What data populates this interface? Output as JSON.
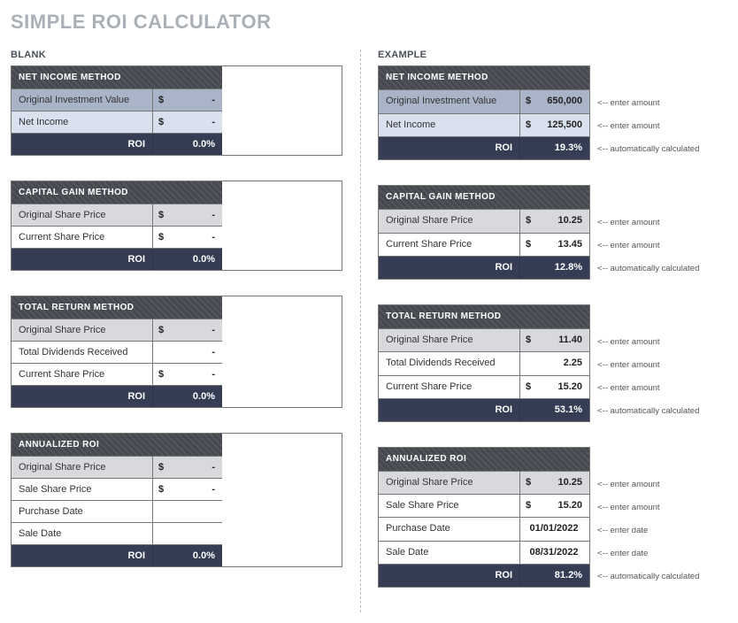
{
  "title": "SIMPLE ROI CALCULATOR",
  "labels": {
    "blank": "BLANK",
    "example": "EXAMPLE",
    "roi": "ROI"
  },
  "methods": {
    "net_income": {
      "title": "NET INCOME METHOD",
      "rows": [
        "Original Investment Value",
        "Net Income"
      ]
    },
    "capital_gain": {
      "title": "CAPITAL GAIN METHOD",
      "rows": [
        "Original Share Price",
        "Current Share Price"
      ]
    },
    "total_return": {
      "title": "TOTAL RETURN METHOD",
      "rows": [
        "Original Share Price",
        "Total Dividends Received",
        "Current Share Price"
      ]
    },
    "annualized": {
      "title": "ANNUALIZED ROI",
      "rows": [
        "Original Share Price",
        "Sale Share Price",
        "Purchase Date",
        "Sale Date"
      ]
    }
  },
  "blank": {
    "net_income": {
      "v": [
        "-",
        "-"
      ],
      "sym": [
        "$",
        "$"
      ],
      "roi": "0.0%"
    },
    "capital_gain": {
      "v": [
        "-",
        "-"
      ],
      "sym": [
        "$",
        "$"
      ],
      "roi": "0.0%"
    },
    "total_return": {
      "v": [
        "-",
        "-",
        "-"
      ],
      "sym": [
        "$",
        "",
        "$"
      ],
      "roi": "0.0%"
    },
    "annualized": {
      "v": [
        "-",
        "-",
        "",
        ""
      ],
      "sym": [
        "$",
        "$",
        "",
        ""
      ],
      "roi": "0.0%"
    }
  },
  "example": {
    "net_income": {
      "v": [
        "650,000",
        "125,500"
      ],
      "sym": [
        "$",
        "$"
      ],
      "roi": "19.3%"
    },
    "capital_gain": {
      "v": [
        "10.25",
        "13.45"
      ],
      "sym": [
        "$",
        "$"
      ],
      "roi": "12.8%"
    },
    "total_return": {
      "v": [
        "11.40",
        "2.25",
        "15.20"
      ],
      "sym": [
        "$",
        "",
        "$"
      ],
      "roi": "53.1%"
    },
    "annualized": {
      "v": [
        "10.25",
        "15.20",
        "01/01/2022",
        "08/31/2022"
      ],
      "sym": [
        "$",
        "$",
        "",
        ""
      ],
      "roi": "81.2%"
    }
  },
  "annot": {
    "amount": "<-- enter amount",
    "date": "<-- enter date",
    "calc": "<-- automatically calculated"
  }
}
